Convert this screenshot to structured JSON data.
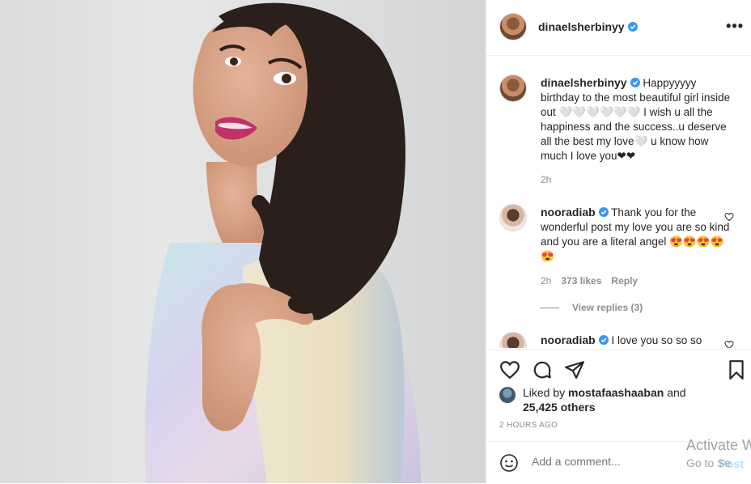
{
  "post": {
    "author": "dinaelsherbinyy",
    "more_label": "•••"
  },
  "caption": {
    "author": "dinaelsherbinyy",
    "text": "Happyyyyy birthday to the most beautiful girl inside out 🤍🤍🤍🤍🤍🤍 I wish u all the happiness and the success..u deserve all the best my love🤍 u know how much I love you❤❤",
    "time": "2h"
  },
  "comments": [
    {
      "author": "nooradiab",
      "text": "Thank you for the wonderful post my love you are so kind and you are a literal angel 😍😍😍😍😍",
      "time": "2h",
      "likes": "373 likes",
      "reply_label": "Reply",
      "view_replies": "View replies (3)"
    },
    {
      "author": "nooradiab",
      "text": "I love you so so so"
    }
  ],
  "likes": {
    "prefix": "Liked by ",
    "user": "mostafaashaaban",
    "mid": " and",
    "others": "25,425 others"
  },
  "timestamp": "2 HOURS AGO",
  "add_comment": {
    "placeholder": "Add a comment...",
    "post_label": "Post"
  },
  "watermark": {
    "line1": "Activate W",
    "line2": "Go to Se"
  },
  "colors": {
    "verified": "#3897f0",
    "heart": "#d10000",
    "post_button": "#b2dffc"
  },
  "icons": [
    "heart-icon",
    "comment-icon",
    "share-icon",
    "bookmark-icon",
    "emoji-icon",
    "verified-badge-icon",
    "more-options-icon"
  ]
}
